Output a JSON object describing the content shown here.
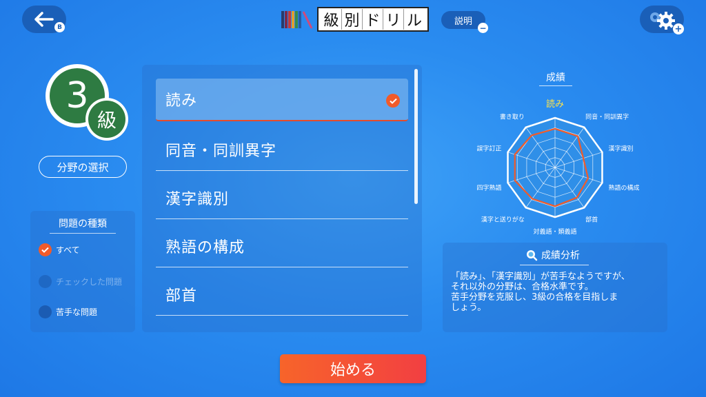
{
  "header": {
    "title_chars": [
      "級",
      "別",
      "ド",
      "リ",
      "ル"
    ],
    "help_label": "説明",
    "back_badge": "B",
    "help_badge": "−",
    "settings_badge": "+"
  },
  "grade": {
    "number": "3",
    "suffix": "級"
  },
  "field_select_label": "分野の選択",
  "question_types": {
    "title": "問題の種類",
    "options": [
      {
        "label": "すべて",
        "checked": true,
        "enabled": true
      },
      {
        "label": "チェックした問題",
        "checked": false,
        "enabled": false
      },
      {
        "label": "苦手な問題",
        "checked": false,
        "enabled": true
      }
    ]
  },
  "fields": [
    {
      "label": "読み",
      "selected": true
    },
    {
      "label": "同音・同訓異字",
      "selected": false
    },
    {
      "label": "漢字識別",
      "selected": false
    },
    {
      "label": "熟語の構成",
      "selected": false
    },
    {
      "label": "部首",
      "selected": false
    }
  ],
  "scores": {
    "title": "成績",
    "axes": [
      "読み",
      "同音・同訓異字",
      "漢字識別",
      "熟語の構成",
      "部首",
      "対義語・類義語",
      "漢字と送りがな",
      "四字熟語",
      "誤字訂正",
      "書き取り"
    ],
    "highlight_axis": "読み",
    "values": [
      0.78,
      0.78,
      0.6,
      0.7,
      0.75,
      0.78,
      0.78,
      0.85,
      0.85,
      0.8
    ]
  },
  "analysis": {
    "title": "成績分析",
    "lines": [
      "「読み」、「漢字識別」が苦手なようですが、",
      "それ以外の分野は、合格水準です。",
      "苦手分野を克服し、3級の合格を目指しま",
      "しょう。"
    ]
  },
  "start_label": "始める",
  "colors": {
    "accent": "#f15b2a",
    "grade": "#2e7b42",
    "button_dark": "#1a5fb8"
  }
}
